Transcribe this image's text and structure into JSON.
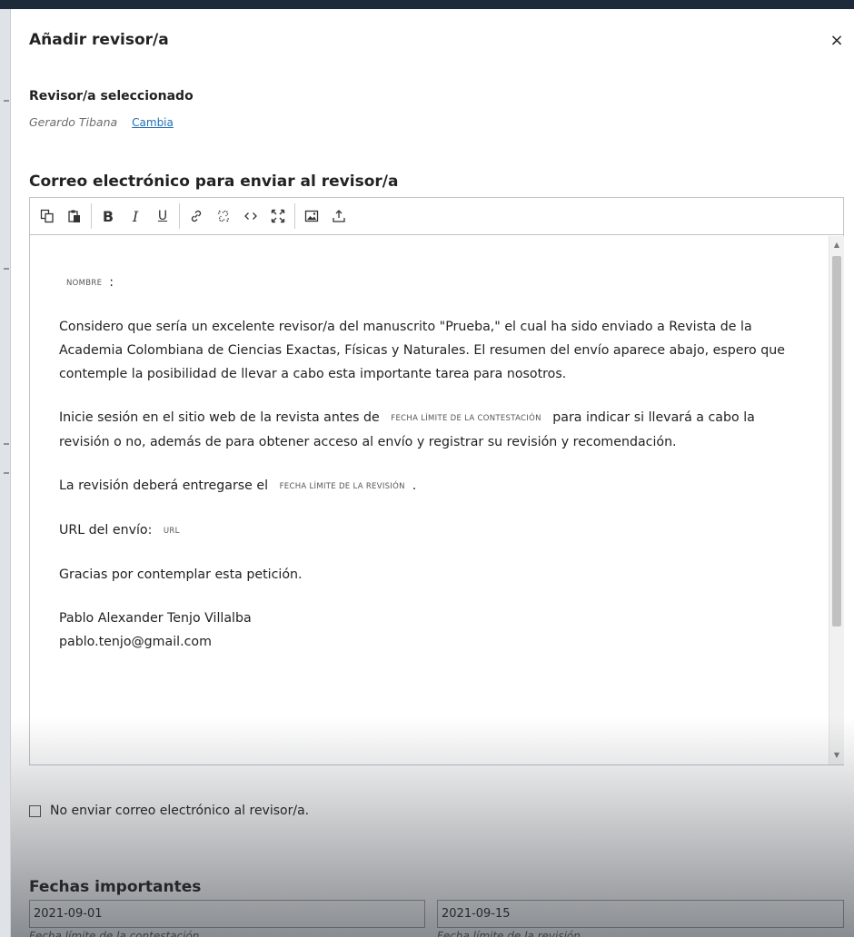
{
  "modal": {
    "title": "Añadir revisor/a",
    "close_glyph": "×"
  },
  "reviewer": {
    "section_label": "Revisor/a seleccionado",
    "name": "Gerardo Tibana",
    "change_label": "Cambia"
  },
  "email": {
    "heading": "Correo electrónico para enviar al revisor/a",
    "toolbar": [
      {
        "name": "copy-icon",
        "glyph": "⧉"
      },
      {
        "name": "paste-icon",
        "glyph": "📋"
      },
      {
        "name": "bold-icon",
        "glyph": "B"
      },
      {
        "name": "italic-icon",
        "glyph": "I"
      },
      {
        "name": "underline-icon",
        "glyph": "U"
      },
      {
        "name": "link-icon",
        "glyph": "🔗"
      },
      {
        "name": "unlink-icon",
        "glyph": "⛓"
      },
      {
        "name": "code-icon",
        "glyph": "<>"
      },
      {
        "name": "fullscreen-icon",
        "glyph": "⛶"
      },
      {
        "name": "image-icon",
        "glyph": "🖼"
      },
      {
        "name": "upload-icon",
        "glyph": "⤒"
      }
    ],
    "body": {
      "greeting_var": "NOMBRE",
      "greeting_suffix": ":",
      "p1": "Considero que sería un excelente revisor/a del manuscrito \"Prueba,\" el cual ha sido enviado a Revista de la Academia Colombiana de Ciencias Exactas, Físicas y Naturales. El resumen del envío aparece abajo, espero que contemple la posibilidad de llevar a cabo esta importante tarea para nosotros.",
      "p2_before": "Inicie sesión en el sitio web de la revista antes de",
      "p2_var": "FECHA LÍMITE DE LA CONTESTACIÓN",
      "p2_after": "para indicar si llevará a cabo la revisión o no, además de para obtener acceso al envío y registrar su revisión y recomendación.",
      "p3_before": "La revisión deberá entregarse el",
      "p3_var": "FECHA LÍMITE DE LA REVISIÓN",
      "p3_after": ".",
      "p4_before": "URL del envío:",
      "p4_var": "URL",
      "p5": "Gracias por contemplar esta petición.",
      "sig_name": "Pablo Alexander Tenjo Villalba",
      "sig_email": "pablo.tenjo@gmail.com"
    },
    "scroll_position": 0.02
  },
  "no_email": {
    "label": "No enviar correo electrónico al revisor/a."
  },
  "dates": {
    "heading": "Fechas importantes",
    "response_due": "2021-09-01",
    "response_due_hint": "Fecha límite de la contestación",
    "review_due": "2021-09-15",
    "review_due_hint": "Fecha límite de la revisión"
  },
  "colors": {
    "link": "#1e6fb3",
    "header_bar": "#1c2a3a"
  }
}
